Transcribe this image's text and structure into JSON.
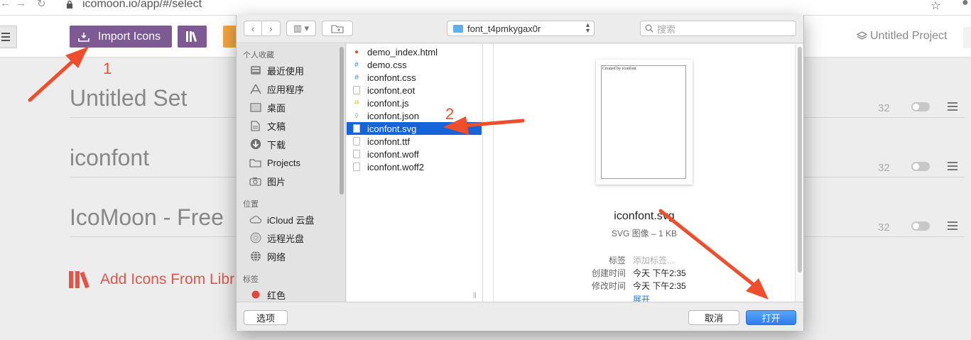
{
  "browser": {
    "url": "icomoon.io/app/#/select"
  },
  "header": {
    "import_label": "Import Icons",
    "project_label": "Untitled Project"
  },
  "sets": [
    {
      "name": "Untitled Set",
      "count": "32"
    },
    {
      "name": "iconfont",
      "count": "32"
    },
    {
      "name": "IcoMoon - Free",
      "count": "32"
    }
  ],
  "add_library_label": "Add Icons From Libr",
  "dialog": {
    "path": "font_t4pmkygax0r",
    "search_placeholder": "搜索",
    "sidebar": {
      "favorites_title": "个人收藏",
      "favorites": [
        {
          "label": "最近使用",
          "icon": "clock-icon"
        },
        {
          "label": "应用程序",
          "icon": "apps-icon"
        },
        {
          "label": "桌面",
          "icon": "desktop-icon"
        },
        {
          "label": "文稿",
          "icon": "document-icon"
        },
        {
          "label": "下载",
          "icon": "download-icon"
        },
        {
          "label": "Projects",
          "icon": "folder-icon"
        },
        {
          "label": "图片",
          "icon": "camera-icon"
        }
      ],
      "locations_title": "位置",
      "locations": [
        {
          "label": "iCloud 云盘",
          "icon": "cloud-icon"
        },
        {
          "label": "远程光盘",
          "icon": "disc-icon"
        },
        {
          "label": "网络",
          "icon": "network-icon"
        }
      ],
      "tags_title": "标签",
      "tags": [
        {
          "label": "红色",
          "color": "#e5453a"
        }
      ]
    },
    "files": [
      {
        "name": "demo_index.html",
        "badge": "●"
      },
      {
        "name": "demo.css",
        "badge": "#"
      },
      {
        "name": "iconfont.css",
        "badge": "#"
      },
      {
        "name": "iconfont.eot",
        "badge": ""
      },
      {
        "name": "iconfont.js",
        "badge": "JS"
      },
      {
        "name": "iconfont.json",
        "badge": "{}"
      },
      {
        "name": "iconfont.svg",
        "badge": "",
        "selected": true
      },
      {
        "name": "iconfont.ttf",
        "badge": ""
      },
      {
        "name": "iconfont.woff",
        "badge": ""
      },
      {
        "name": "iconfont.woff2",
        "badge": ""
      }
    ],
    "preview": {
      "thumb_text": "Created by iconfont",
      "name": "iconfont.svg",
      "kind": "SVG 图像 – 1 KB",
      "meta": [
        {
          "label": "标签",
          "value": "添加标签...",
          "placeholder": true
        },
        {
          "label": "创建时间",
          "value": "今天 下午2:35"
        },
        {
          "label": "修改时间",
          "value": "今天 下午2:35"
        }
      ],
      "more_label": "展开"
    },
    "options_label": "选项",
    "cancel_label": "取消",
    "open_label": "打开"
  },
  "annotations": {
    "step1": "1",
    "step2": "2",
    "arrow_color": "#ef4e2c"
  }
}
